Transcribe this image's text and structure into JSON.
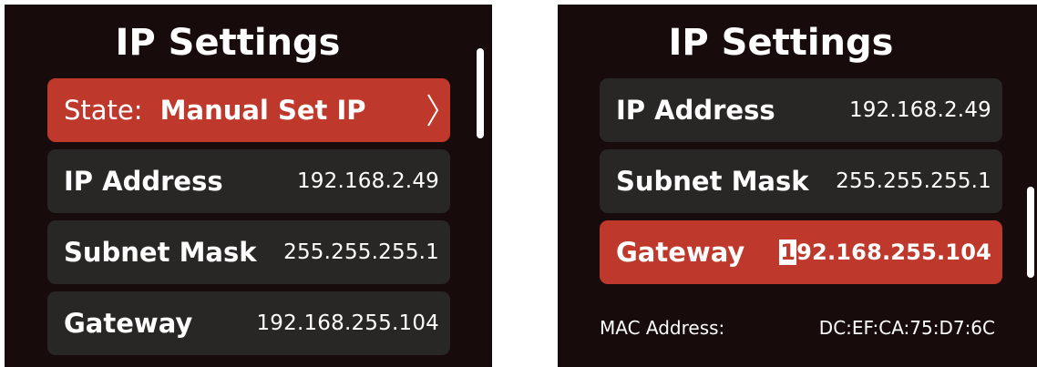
{
  "left_panel": {
    "title": "IP Settings",
    "state": {
      "label": "State:",
      "value": "Manual Set IP"
    },
    "rows": [
      {
        "label": "IP Address",
        "value": "192.168.2.49"
      },
      {
        "label": "Subnet Mask",
        "value": "255.255.255.1"
      },
      {
        "label": "Gateway",
        "value": "192.168.255.104"
      }
    ],
    "selected": "state"
  },
  "right_panel": {
    "title": "IP Settings",
    "rows": [
      {
        "label": "IP Address",
        "value": "192.168.2.49"
      },
      {
        "label": "Subnet Mask",
        "value": "255.255.255.1"
      }
    ],
    "gateway": {
      "label": "Gateway",
      "cursor_char": "1",
      "value_rest": "92.168.255.104"
    },
    "selected": "gateway",
    "mac": {
      "label": "MAC Address:",
      "value": "DC:EF:CA:75:D7:6C"
    }
  },
  "colors": {
    "background": "#170b0b",
    "row": "#292626",
    "selected": "#bf382c",
    "text": "#ffffff"
  },
  "icons": [
    "chevron-right-icon"
  ]
}
